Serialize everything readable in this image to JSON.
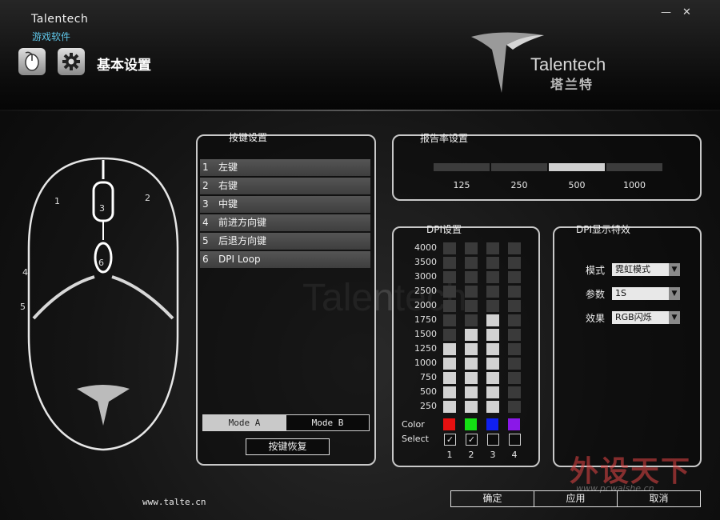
{
  "app": {
    "brand": "Talentech",
    "subtitle": "游戏软件",
    "page_title": "基本设置",
    "window_controls": {
      "minimize": "—",
      "close": "✕"
    },
    "logo": {
      "text": "Talentech",
      "cn": "塔兰特"
    },
    "bg_watermark": "Talentech"
  },
  "icons": {
    "mouse": "mouse-icon",
    "settings": "gear-icon"
  },
  "mouse_buttons": [
    "1",
    "2",
    "3",
    "4",
    "5",
    "6"
  ],
  "key_settings": {
    "title": "按键设置",
    "items": [
      {
        "num": "1",
        "label": "左键"
      },
      {
        "num": "2",
        "label": "右键"
      },
      {
        "num": "3",
        "label": "中键"
      },
      {
        "num": "4",
        "label": "前进方向键"
      },
      {
        "num": "5",
        "label": "后退方向键"
      },
      {
        "num": "6",
        "label": "DPI Loop"
      }
    ],
    "mode_a": "Mode A",
    "mode_b": "Mode B",
    "active_mode": "Mode A",
    "restore_button": "按键恢复"
  },
  "report_rate": {
    "title": "报告率设置",
    "options": [
      "125",
      "250",
      "500",
      "1000"
    ],
    "selected": "500"
  },
  "dpi": {
    "title": "DPI设置",
    "levels": [
      "4000",
      "3500",
      "3000",
      "2500",
      "2000",
      "1750",
      "1500",
      "1250",
      "1000",
      "750",
      "500",
      "250"
    ],
    "color_label": "Color",
    "select_label": "Select",
    "columns": [
      {
        "num": "1",
        "color": "#e81010",
        "value": 1250,
        "selected": true
      },
      {
        "num": "2",
        "color": "#14e014",
        "value": 1500,
        "selected": true
      },
      {
        "num": "3",
        "color": "#1020f0",
        "value": 1750,
        "selected": false
      },
      {
        "num": "4",
        "color": "#8a18e8",
        "value": 0,
        "selected": false
      }
    ]
  },
  "dpi_effect": {
    "title": "DPI显示特效",
    "mode_label": "模式",
    "mode_value": "霓虹模式",
    "param_label": "参数",
    "param_value": "1S",
    "effect_label": "效果",
    "effect_value": "RGB闪烁"
  },
  "footer": {
    "url": "www.talte.cn",
    "confirm": "确定",
    "apply": "应用",
    "cancel": "取消"
  },
  "site_watermark": {
    "cn": "外设天下",
    "url": "www.pcwaishe.cn"
  }
}
